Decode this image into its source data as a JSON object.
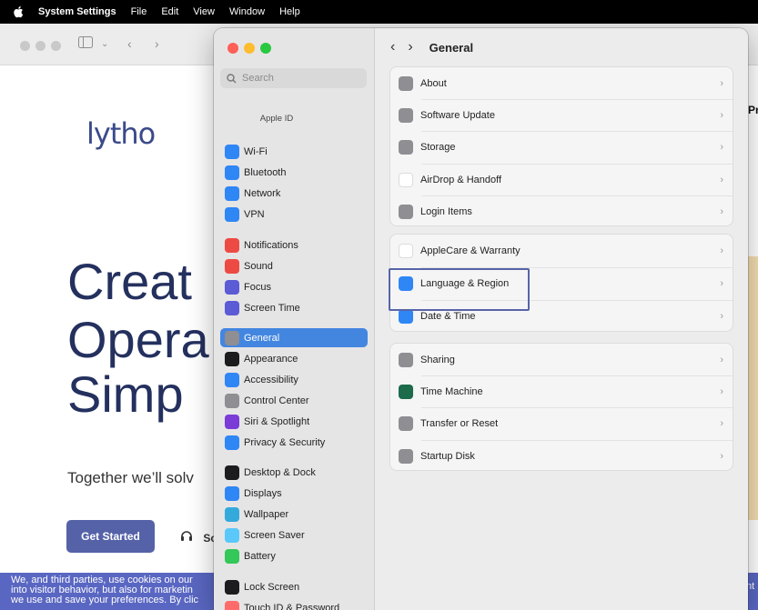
{
  "menubar": {
    "app": "System Settings",
    "items": [
      "File",
      "Edit",
      "View",
      "Window",
      "Help"
    ]
  },
  "browser": {
    "logo": "lytho",
    "hero_lines": [
      "Creat",
      "Opera",
      "Simp"
    ],
    "subtitle": "Together we’ll solv",
    "cta": "Get Started",
    "secondary": "Sc",
    "right_text": "Pr",
    "cookie_lines": [
      "We, and third parties, use cookies on our",
      "into visitor behavior, but also for marketin",
      "we use and save your preferences. By clic"
    ],
    "cookie_right": "nt"
  },
  "sidebar": {
    "search_placeholder": "Search",
    "apple_id": "Apple ID",
    "items": [
      {
        "label": "Wi-Fi",
        "icon": "wifi-icon",
        "color": "#2f86f5"
      },
      {
        "label": "Bluetooth",
        "icon": "bluetooth-icon",
        "color": "#2f86f5"
      },
      {
        "label": "Network",
        "icon": "globe-icon",
        "color": "#2f86f5"
      },
      {
        "label": "VPN",
        "icon": "vpn-icon",
        "color": "#2f86f5"
      },
      {
        "label": "Notifications",
        "icon": "bell-icon",
        "color": "#ee4a44"
      },
      {
        "label": "Sound",
        "icon": "speaker-icon",
        "color": "#ee4a44"
      },
      {
        "label": "Focus",
        "icon": "moon-icon",
        "color": "#5b5bd6"
      },
      {
        "label": "Screen Time",
        "icon": "hourglass-icon",
        "color": "#5b5bd6"
      },
      {
        "label": "General",
        "icon": "gear-icon",
        "color": "#8e8e93"
      },
      {
        "label": "Appearance",
        "icon": "appearance-icon",
        "color": "#1c1c1e"
      },
      {
        "label": "Accessibility",
        "icon": "accessibility-icon",
        "color": "#2f86f5"
      },
      {
        "label": "Control Center",
        "icon": "control-center-icon",
        "color": "#8e8e93"
      },
      {
        "label": "Siri & Spotlight",
        "icon": "siri-icon",
        "color": "#7a3bd6"
      },
      {
        "label": "Privacy & Security",
        "icon": "hand-icon",
        "color": "#2f86f5"
      },
      {
        "label": "Desktop & Dock",
        "icon": "dock-icon",
        "color": "#1c1c1e"
      },
      {
        "label": "Displays",
        "icon": "sun-icon",
        "color": "#2f86f5"
      },
      {
        "label": "Wallpaper",
        "icon": "wallpaper-icon",
        "color": "#34aadc"
      },
      {
        "label": "Screen Saver",
        "icon": "screensaver-icon",
        "color": "#5ac8fa"
      },
      {
        "label": "Battery",
        "icon": "battery-icon",
        "color": "#34c759"
      },
      {
        "label": "Lock Screen",
        "icon": "lock-icon",
        "color": "#1c1c1e"
      },
      {
        "label": "Touch ID & Password",
        "icon": "fingerprint-icon",
        "color": "#ff6b6b"
      }
    ]
  },
  "pane": {
    "back": "‹",
    "forward": "›",
    "title": "General",
    "groups": [
      [
        {
          "label": "About",
          "icon": "about-icon",
          "color": "#8e8e93"
        },
        {
          "label": "Software Update",
          "icon": "software-update-icon",
          "color": "#8e8e93"
        },
        {
          "label": "Storage",
          "icon": "storage-icon",
          "color": "#8e8e93"
        },
        {
          "label": "AirDrop & Handoff",
          "icon": "airdrop-icon",
          "color": "#ffffff"
        },
        {
          "label": "Login Items",
          "icon": "login-items-icon",
          "color": "#8e8e93"
        }
      ],
      [
        {
          "label": "AppleCare & Warranty",
          "icon": "applecare-icon",
          "color": "#ffffff"
        },
        {
          "label": "Language & Region",
          "icon": "globe-icon",
          "color": "#2f86f5"
        },
        {
          "label": "Date & Time",
          "icon": "calendar-icon",
          "color": "#2f86f5"
        }
      ],
      [
        {
          "label": "Sharing",
          "icon": "sharing-icon",
          "color": "#8e8e93"
        },
        {
          "label": "Time Machine",
          "icon": "time-machine-icon",
          "color": "#1c6b4a"
        },
        {
          "label": "Transfer or Reset",
          "icon": "reset-icon",
          "color": "#8e8e93"
        },
        {
          "label": "Startup Disk",
          "icon": "startup-disk-icon",
          "color": "#8e8e93"
        }
      ]
    ]
  }
}
